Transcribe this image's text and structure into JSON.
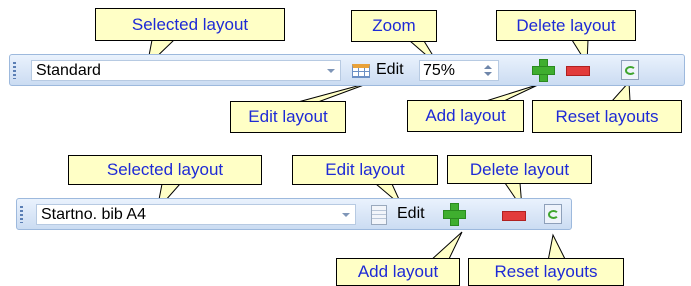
{
  "toolbar1": {
    "layout_value": "Standard",
    "edit_label": "Edit",
    "zoom_value": "75%"
  },
  "toolbar2": {
    "layout_value": "Startno. bib A4",
    "edit_label": "Edit"
  },
  "callouts": {
    "selected_layout_1": "Selected layout",
    "zoom": "Zoom",
    "delete_layout_1": "Delete layout",
    "edit_layout_1": "Edit layout",
    "add_layout_1": "Add layout",
    "reset_layouts_1": "Reset layouts",
    "selected_layout_2": "Selected layout",
    "edit_layout_2": "Edit layout",
    "delete_layout_2": "Delete layout",
    "add_layout_2": "Add layout",
    "reset_layouts_2": "Reset layouts"
  },
  "colors": {
    "callout_fill": "#ffffc6",
    "callout_text": "#1e2ad6",
    "toolbar_bg": "#cbdcf2",
    "add_green": "#3fae2f",
    "delete_red": "#e23b3b"
  },
  "icons": [
    "grip-icon",
    "edit-grid-icon",
    "edit-doc-icon",
    "add-icon",
    "delete-icon",
    "reset-icon",
    "combo-arrow-icon",
    "spin-icon"
  ]
}
